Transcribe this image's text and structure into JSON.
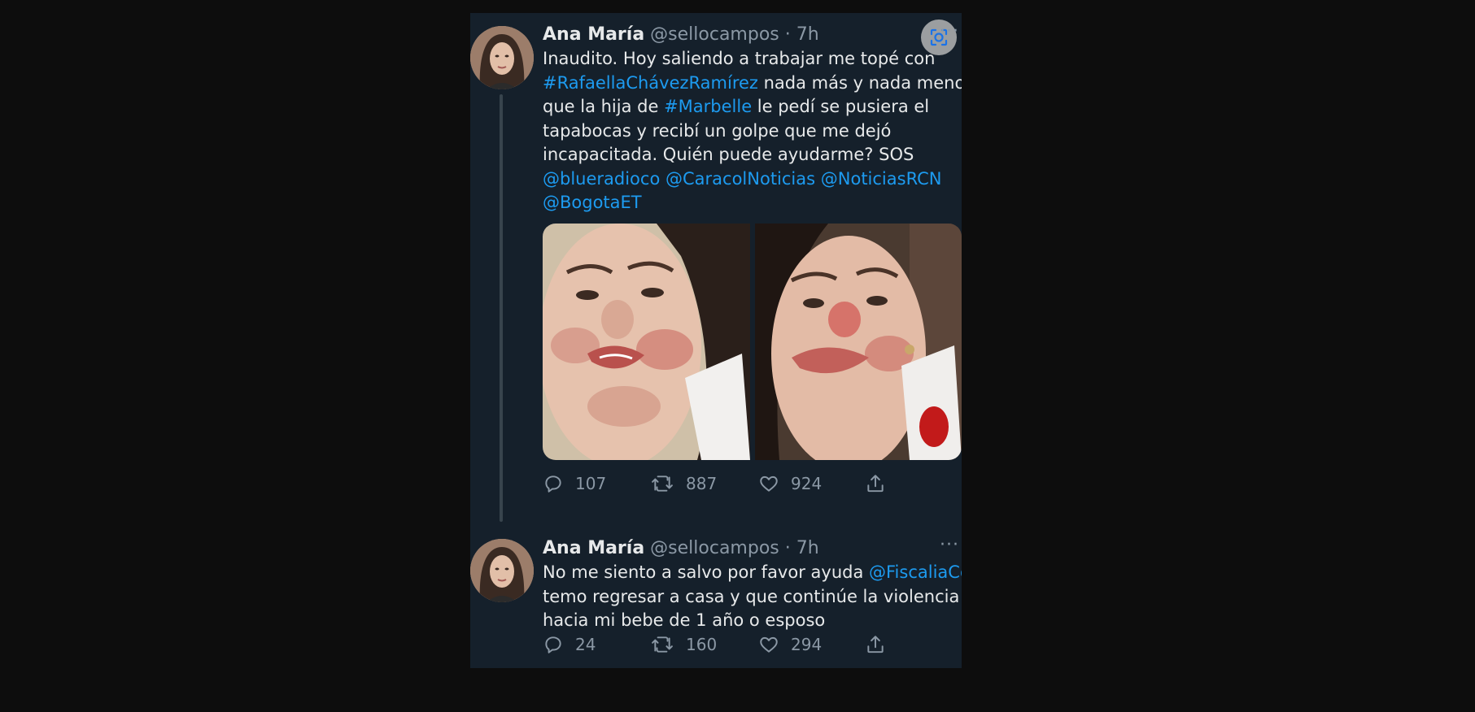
{
  "tweets": [
    {
      "author_name": "Ana María",
      "author_handle": "@sellocampos",
      "time": "7h",
      "text_lines": [
        [
          {
            "t": "Inaudito. Hoy saliendo a trabajar me topé con",
            "link": false
          }
        ],
        [
          {
            "t": "#RafaellaChávezRamírez",
            "link": true
          },
          {
            "t": " nada más y nada menos",
            "link": false
          }
        ],
        [
          {
            "t": "que la hija de ",
            "link": false
          },
          {
            "t": "#Marbelle",
            "link": true
          },
          {
            "t": " le pedí se pusiera el",
            "link": false
          }
        ],
        [
          {
            "t": "tapabocas y recibí un golpe que me dejó",
            "link": false
          }
        ],
        [
          {
            "t": "incapacitada. Quién puede ayudarme? SOS",
            "link": false
          }
        ],
        [
          {
            "t": "@blueradioco",
            "link": true
          },
          {
            "t": " ",
            "link": false
          },
          {
            "t": "@CaracolNoticias",
            "link": true
          },
          {
            "t": "  ",
            "link": false
          },
          {
            "t": "@NoticiasRCN",
            "link": true
          }
        ],
        [
          {
            "t": "@BogotaET",
            "link": true
          }
        ]
      ],
      "replies": "107",
      "retweets": "887",
      "likes": "924"
    },
    {
      "author_name": "Ana María",
      "author_handle": "@sellocampos",
      "time": "7h",
      "text_lines": [
        [
          {
            "t": "No me siento a salvo por favor ayuda ",
            "link": false
          },
          {
            "t": "@FiscaliaCol",
            "link": true
          }
        ],
        [
          {
            "t": "temo regresar a casa y que continúe la violencia",
            "link": false
          }
        ],
        [
          {
            "t": "hacia mi bebe de 1 año o esposo",
            "link": false
          }
        ]
      ],
      "replies": "24",
      "retweets": "160",
      "likes": "294"
    }
  ],
  "icons": {
    "more": "more-horizontal-icon",
    "reply": "reply-bubble-icon",
    "retweet": "retweet-icon",
    "like": "heart-icon",
    "share": "share-icon",
    "lens": "image-search-icon"
  },
  "colors": {
    "background": "#0d0d0d",
    "card": "#15202b",
    "text": "#e7e9ea",
    "secondary": "#8b98a5",
    "link": "#1d9bf0"
  }
}
